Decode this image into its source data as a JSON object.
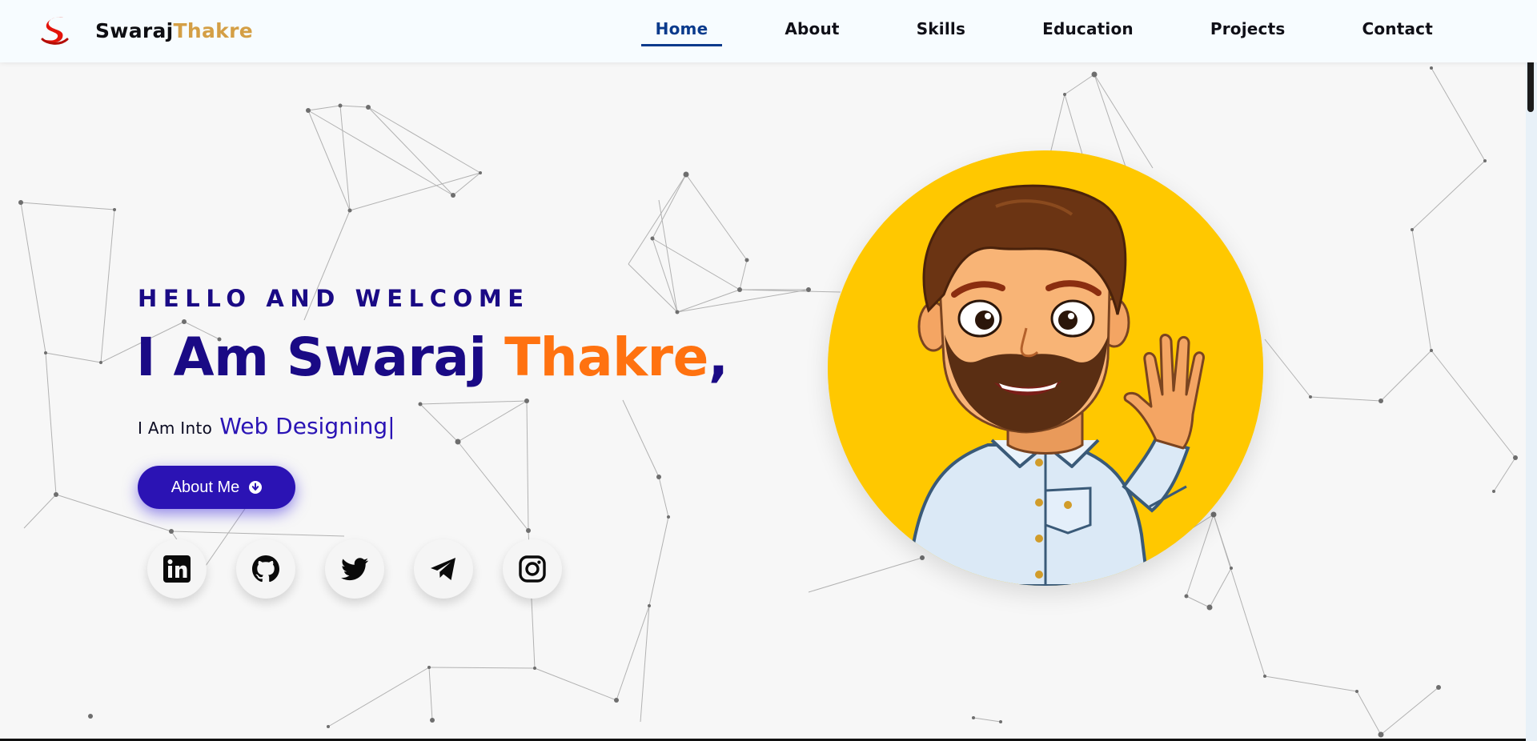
{
  "brand": {
    "first_name": "Swaraj",
    "last_name": "Thakre",
    "logo_icon": "s-logo-icon",
    "logo_color": "#e3140b"
  },
  "nav": {
    "items": [
      {
        "label": "Home",
        "active": true
      },
      {
        "label": "About"
      },
      {
        "label": "Skills"
      },
      {
        "label": "Education"
      },
      {
        "label": "Projects"
      },
      {
        "label": "Contact"
      }
    ],
    "active_color": "#0a3a8c"
  },
  "hero": {
    "eyebrow": "HELLO AND WELCOME",
    "headline_prefix": "I Am Swaraj ",
    "headline_accent": "Thakre",
    "headline_suffix": ",",
    "typing_prefix": "I Am Into",
    "typing_word": "Web Designing",
    "typing_caret": "|",
    "about_button": {
      "label": "About Me",
      "icon": "arrow-down-circle-icon"
    },
    "colors": {
      "primary": "#1a0a85",
      "accent": "#ff7210",
      "button": "#2b13b4"
    }
  },
  "socials": [
    {
      "name": "linkedin",
      "icon": "linkedin-icon"
    },
    {
      "name": "github",
      "icon": "github-icon"
    },
    {
      "name": "twitter",
      "icon": "twitter-icon"
    },
    {
      "name": "telegram",
      "icon": "telegram-icon"
    },
    {
      "name": "instagram",
      "icon": "instagram-icon"
    }
  ],
  "avatar": {
    "icon": "waving-cartoon-avatar",
    "background": "#ffc800"
  }
}
